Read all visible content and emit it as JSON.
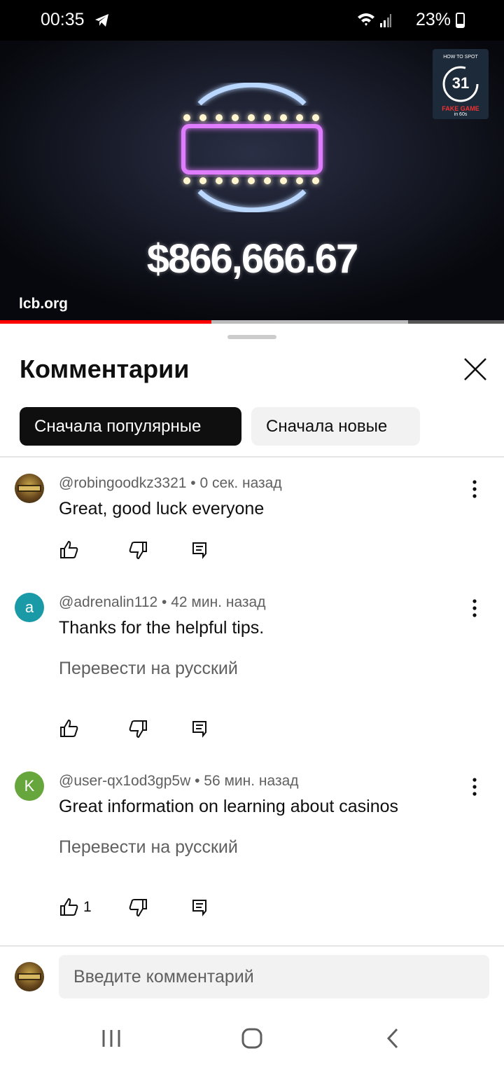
{
  "status_bar": {
    "time": "00:35",
    "battery": "23%"
  },
  "video": {
    "overlay_amount": "$866,666.67",
    "watermark": "lcb.org",
    "thumbnail": {
      "top_text": "HOW TO SPOT",
      "number": "31",
      "label": "FAKE GAME",
      "sub": "in 60s"
    },
    "progress": {
      "played_fraction": 0.42,
      "buffered_fraction": 0.81
    }
  },
  "comments_sheet": {
    "title": "Комментарии",
    "sort_chips": [
      "Сначала популярные",
      "Сначала новые"
    ],
    "comments": [
      {
        "author": "@robingoodkz3321 • 0 сек. назад",
        "text": "Great, good luck everyone",
        "avatar_letter": "",
        "translate": "",
        "likes": ""
      },
      {
        "author": "@adrenalin112 • 42 мин. назад",
        "text": "Thanks for the helpful tips.",
        "avatar_letter": "a",
        "translate": "Перевести на русский",
        "likes": ""
      },
      {
        "author": "@user-qx1od3gp5w • 56 мин. назад",
        "text": "Great information on learning about casinos",
        "avatar_letter": "K",
        "translate": "Перевести на русский",
        "likes": "1"
      }
    ],
    "input_placeholder": "Введите комментарий"
  },
  "icons": [
    "telegram-icon",
    "wifi-icon",
    "signal-icon",
    "battery-icon",
    "close-icon",
    "more-vert-icon",
    "thumb-up-icon",
    "thumb-down-icon",
    "reply-icon",
    "recents-icon",
    "home-icon",
    "back-icon"
  ],
  "colors": {
    "accent_red": "#ff0000",
    "chip_active_bg": "#0f0f0f",
    "chip_inactive_bg": "#f2f2f2",
    "avatar_a": "#1a9aa6",
    "avatar_k": "#67a53d"
  }
}
